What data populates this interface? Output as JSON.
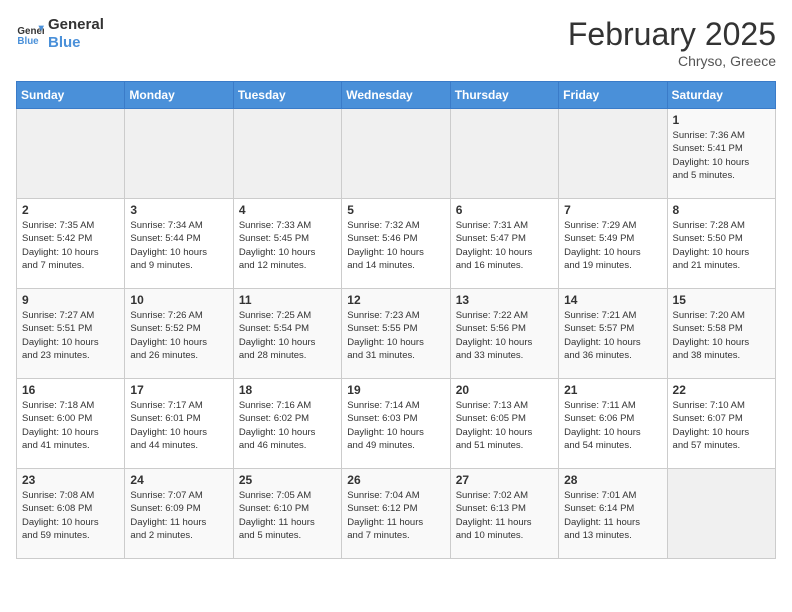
{
  "header": {
    "logo_line1": "General",
    "logo_line2": "Blue",
    "title": "February 2025",
    "subtitle": "Chryso, Greece"
  },
  "calendar": {
    "days_of_week": [
      "Sunday",
      "Monday",
      "Tuesday",
      "Wednesday",
      "Thursday",
      "Friday",
      "Saturday"
    ],
    "weeks": [
      [
        {
          "day": "",
          "info": ""
        },
        {
          "day": "",
          "info": ""
        },
        {
          "day": "",
          "info": ""
        },
        {
          "day": "",
          "info": ""
        },
        {
          "day": "",
          "info": ""
        },
        {
          "day": "",
          "info": ""
        },
        {
          "day": "1",
          "info": "Sunrise: 7:36 AM\nSunset: 5:41 PM\nDaylight: 10 hours\nand 5 minutes."
        }
      ],
      [
        {
          "day": "2",
          "info": "Sunrise: 7:35 AM\nSunset: 5:42 PM\nDaylight: 10 hours\nand 7 minutes."
        },
        {
          "day": "3",
          "info": "Sunrise: 7:34 AM\nSunset: 5:44 PM\nDaylight: 10 hours\nand 9 minutes."
        },
        {
          "day": "4",
          "info": "Sunrise: 7:33 AM\nSunset: 5:45 PM\nDaylight: 10 hours\nand 12 minutes."
        },
        {
          "day": "5",
          "info": "Sunrise: 7:32 AM\nSunset: 5:46 PM\nDaylight: 10 hours\nand 14 minutes."
        },
        {
          "day": "6",
          "info": "Sunrise: 7:31 AM\nSunset: 5:47 PM\nDaylight: 10 hours\nand 16 minutes."
        },
        {
          "day": "7",
          "info": "Sunrise: 7:29 AM\nSunset: 5:49 PM\nDaylight: 10 hours\nand 19 minutes."
        },
        {
          "day": "8",
          "info": "Sunrise: 7:28 AM\nSunset: 5:50 PM\nDaylight: 10 hours\nand 21 minutes."
        }
      ],
      [
        {
          "day": "9",
          "info": "Sunrise: 7:27 AM\nSunset: 5:51 PM\nDaylight: 10 hours\nand 23 minutes."
        },
        {
          "day": "10",
          "info": "Sunrise: 7:26 AM\nSunset: 5:52 PM\nDaylight: 10 hours\nand 26 minutes."
        },
        {
          "day": "11",
          "info": "Sunrise: 7:25 AM\nSunset: 5:54 PM\nDaylight: 10 hours\nand 28 minutes."
        },
        {
          "day": "12",
          "info": "Sunrise: 7:23 AM\nSunset: 5:55 PM\nDaylight: 10 hours\nand 31 minutes."
        },
        {
          "day": "13",
          "info": "Sunrise: 7:22 AM\nSunset: 5:56 PM\nDaylight: 10 hours\nand 33 minutes."
        },
        {
          "day": "14",
          "info": "Sunrise: 7:21 AM\nSunset: 5:57 PM\nDaylight: 10 hours\nand 36 minutes."
        },
        {
          "day": "15",
          "info": "Sunrise: 7:20 AM\nSunset: 5:58 PM\nDaylight: 10 hours\nand 38 minutes."
        }
      ],
      [
        {
          "day": "16",
          "info": "Sunrise: 7:18 AM\nSunset: 6:00 PM\nDaylight: 10 hours\nand 41 minutes."
        },
        {
          "day": "17",
          "info": "Sunrise: 7:17 AM\nSunset: 6:01 PM\nDaylight: 10 hours\nand 44 minutes."
        },
        {
          "day": "18",
          "info": "Sunrise: 7:16 AM\nSunset: 6:02 PM\nDaylight: 10 hours\nand 46 minutes."
        },
        {
          "day": "19",
          "info": "Sunrise: 7:14 AM\nSunset: 6:03 PM\nDaylight: 10 hours\nand 49 minutes."
        },
        {
          "day": "20",
          "info": "Sunrise: 7:13 AM\nSunset: 6:05 PM\nDaylight: 10 hours\nand 51 minutes."
        },
        {
          "day": "21",
          "info": "Sunrise: 7:11 AM\nSunset: 6:06 PM\nDaylight: 10 hours\nand 54 minutes."
        },
        {
          "day": "22",
          "info": "Sunrise: 7:10 AM\nSunset: 6:07 PM\nDaylight: 10 hours\nand 57 minutes."
        }
      ],
      [
        {
          "day": "23",
          "info": "Sunrise: 7:08 AM\nSunset: 6:08 PM\nDaylight: 10 hours\nand 59 minutes."
        },
        {
          "day": "24",
          "info": "Sunrise: 7:07 AM\nSunset: 6:09 PM\nDaylight: 11 hours\nand 2 minutes."
        },
        {
          "day": "25",
          "info": "Sunrise: 7:05 AM\nSunset: 6:10 PM\nDaylight: 11 hours\nand 5 minutes."
        },
        {
          "day": "26",
          "info": "Sunrise: 7:04 AM\nSunset: 6:12 PM\nDaylight: 11 hours\nand 7 minutes."
        },
        {
          "day": "27",
          "info": "Sunrise: 7:02 AM\nSunset: 6:13 PM\nDaylight: 11 hours\nand 10 minutes."
        },
        {
          "day": "28",
          "info": "Sunrise: 7:01 AM\nSunset: 6:14 PM\nDaylight: 11 hours\nand 13 minutes."
        },
        {
          "day": "",
          "info": ""
        }
      ]
    ]
  }
}
